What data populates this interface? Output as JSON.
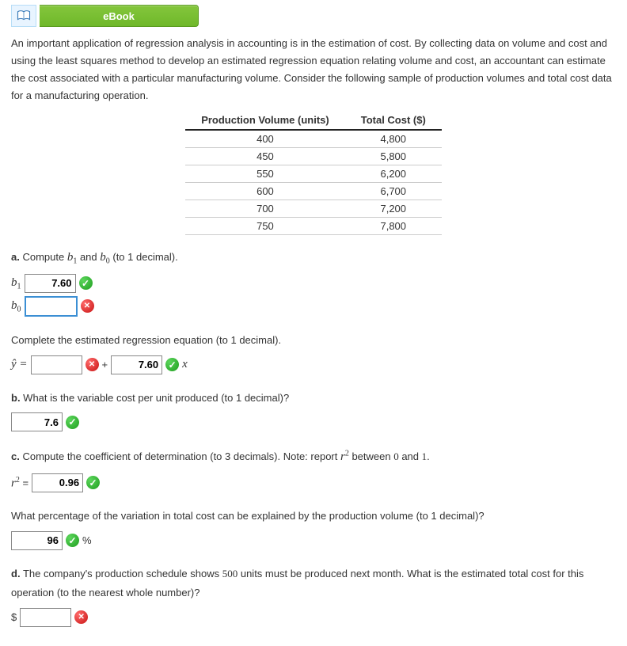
{
  "header": {
    "ebook_label": "eBook"
  },
  "intro": "An important application of regression analysis in accounting is in the estimation of cost. By collecting data on volume and cost and using the least squares method to develop an estimated regression equation relating volume and cost, an accountant can estimate the cost associated with a particular manufacturing volume. Consider the following sample of production volumes and total cost data for a manufacturing operation.",
  "table": {
    "col1": "Production Volume (units)",
    "col2": "Total Cost ($)",
    "rows": [
      {
        "vol": "400",
        "cost": "4,800"
      },
      {
        "vol": "450",
        "cost": "5,800"
      },
      {
        "vol": "550",
        "cost": "6,200"
      },
      {
        "vol": "600",
        "cost": "6,700"
      },
      {
        "vol": "700",
        "cost": "7,200"
      },
      {
        "vol": "750",
        "cost": "7,800"
      }
    ]
  },
  "a": {
    "prompt_prefix": "a.",
    "prompt": " Compute ",
    "prompt_mid": " and ",
    "prompt_suffix": " (to 1 decimal).",
    "b1_val": "7.60",
    "b0_val": ""
  },
  "eq": {
    "prompt": "Complete the estimated regression equation (to 1 decimal).",
    "intercept_val": "",
    "plus": "+",
    "slope_val": "7.60"
  },
  "b": {
    "prompt_prefix": "b.",
    "prompt": " What is the variable cost per unit produced (to 1 decimal)?",
    "val": "7.6"
  },
  "c": {
    "prompt_prefix": "c.",
    "prompt_a": " Compute the coefficient of determination (to 3 decimals). Note: report ",
    "prompt_b": " between ",
    "zero": "0",
    "and": " and ",
    "one": "1",
    "dot": ".",
    "eq": " =",
    "val": "0.96"
  },
  "pct": {
    "prompt": "What percentage of the variation in total cost can be explained by the production volume (to 1 decimal)?",
    "val": "96",
    "sym": "%"
  },
  "d": {
    "prompt_prefix": "d.",
    "prompt_a": " The company's production schedule shows ",
    "units": "500",
    "prompt_b": " units must be produced next month. What is the estimated total cost for this operation (to the nearest whole number)?",
    "dollar": "$",
    "val": ""
  }
}
